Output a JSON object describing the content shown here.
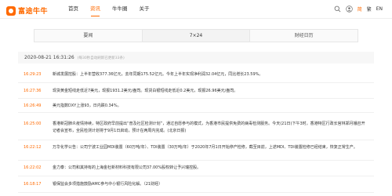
{
  "brand": {
    "name": "富途牛牛",
    "accent": "#ff6a00"
  },
  "nav": [
    {
      "label": "首页",
      "active": false
    },
    {
      "label": "资讯",
      "active": true
    },
    {
      "label": "牛牛圈",
      "active": false
    },
    {
      "label": "关于",
      "active": false
    }
  ],
  "header_right": {
    "lang_simplified": "简",
    "lang_traditional": "繁",
    "lang_english": "EN"
  },
  "tabs": [
    {
      "label": "要闻",
      "active": false
    },
    {
      "label": "7×24",
      "active": true
    },
    {
      "label": "财经日历",
      "active": false
    }
  ],
  "datebar": {
    "date": "2020-08-21 16:31:26",
    "note": "(每30秒自动刷新已更新33条)"
  },
  "news": [
    {
      "time": "16:29:23",
      "text": "新城发展控股：上半年营收377.36亿元，去年同期175.52亿元。今年上半年实现净利润32.04亿元，同比增长23.59%。"
    },
    {
      "time": "16:27:36",
      "text": "现货黄金短线走低近7美元，现报1931.2美元/盎司。现货白银短线走低近0.2美元，现报26.96美元/盎司。"
    },
    {
      "time": "16:26:49",
      "text": "美元指数DXY上涨93，日内跌0.34%。"
    },
    {
      "time": "16:25:00",
      "text": "香港新冠肺炎疫情持续，特区政府早前提出“普及社区检测计划”，通过自愿参与的模式，为香港市民提供免费的病毒检测服务。今天(21日)下午3时，香港特区行政长官林郑月娥召开记者会宣布，全民检测计划将于9月1日启动，预计在两周内完成。(北京日报)"
    },
    {
      "time": "16:22:12",
      "text": "万华化学公告：公司宁波工业园MDI装置（60万吨/年）、TDI装置（30万吨/年）于2020年7月1日开始停产检修，截至目前，上述MDI、TDI装置检修已经结束，恢复正常生产。"
    },
    {
      "time": "16:22:02",
      "text": "金力泰：公司和其持有的上海金杜新材料科技有限公司37.00%股权转让予兴瑞控股。"
    },
    {
      "time": "16:18:17",
      "text": "银保监会多项措施鼓励AMC参与中小银行风险化解。（21财经）"
    }
  ]
}
